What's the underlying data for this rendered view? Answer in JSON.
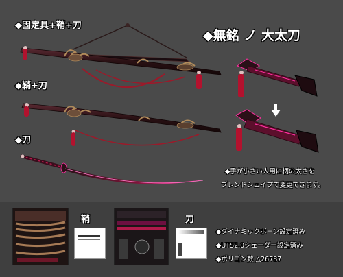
{
  "labels": {
    "set_full": "◆固定具+鞘+刀",
    "set_saya_katana": "◆鞘+刀",
    "set_katana": "◆刀",
    "title": "◆無銘 ノ 大太刀"
  },
  "notes": {
    "line1": "◆手が小さい人用に柄の太さを",
    "line2": "ブレンドシェイプで変更できます。"
  },
  "textures": {
    "saya_label": "鞘",
    "katana_label": "刀"
  },
  "specs": {
    "dynamic_bone": "◆ダイナミックボーン設定済み",
    "shader": "◆UTS2.0シェーダー設定済み",
    "polygons": "◆ポリゴン数 △26787"
  },
  "icons": {
    "arrow": "arrow-down-icon"
  },
  "colors": {
    "background": "#4a4a4a",
    "blade_crimson": "#b01a4a",
    "tassel_red": "#b3122e",
    "gold_ornament": "#b08a5a",
    "magenta_glow": "#ff2fa0"
  }
}
